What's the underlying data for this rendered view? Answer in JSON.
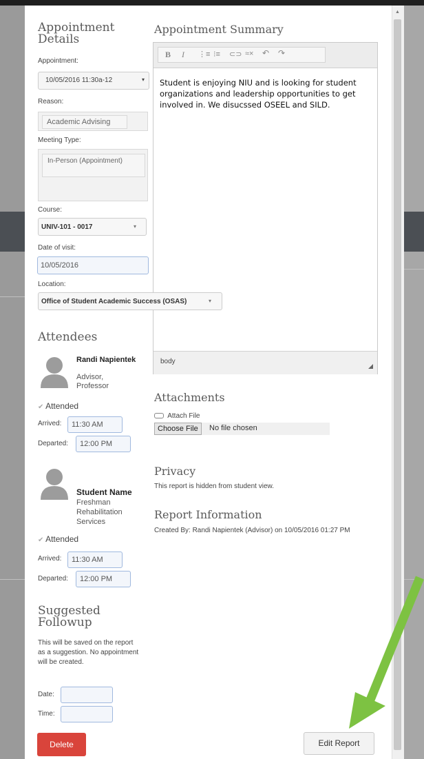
{
  "details": {
    "title": "Appointment Details",
    "appointment_label": "Appointment:",
    "appointment_value": "10/05/2016 11:30a-12",
    "reason_label": "Reason:",
    "reason_value": "Academic Advising",
    "meeting_type_label": "Meeting Type:",
    "meeting_type_value": "In-Person (Appointment)",
    "course_label": "Course:",
    "course_value": "UNIV-101 - 0017",
    "date_label": "Date of visit:",
    "date_value": "10/05/2016",
    "location_label": "Location:",
    "location_value": "Office of Student Academic Success (OSAS)"
  },
  "attendees": {
    "title": "Attendees",
    "people": [
      {
        "name": "Randi Napientek",
        "role": "Advisor, Professor",
        "attended_label": "Attended",
        "arrived_label": "Arrived:",
        "arrived_value": "11:30 AM",
        "departed_label": "Departed:",
        "departed_value": "12:00 PM"
      },
      {
        "name": "Student Name",
        "role": "Freshman Rehabilitation Services",
        "attended_label": "Attended",
        "arrived_label": "Arrived:",
        "arrived_value": "11:30 AM",
        "departed_label": "Departed:",
        "departed_value": "12:00 PM"
      }
    ]
  },
  "followup": {
    "title": "Suggested Followup",
    "note": "This will be saved on the report as a suggestion. No appointment will be created.",
    "date_label": "Date:",
    "time_label": "Time:"
  },
  "summary": {
    "title": "Appointment Summary",
    "text": "Student is enjoying NIU and is looking for student organizations and leadership opportunities to get involved in. We disucssed OSEEL and SILD.",
    "status_bar": "body",
    "toolbar_icons": [
      "bold-icon",
      "italic-icon",
      "ordered-list-icon",
      "unordered-list-icon",
      "link-icon",
      "unlink-icon",
      "undo-icon",
      "redo-icon"
    ]
  },
  "attachments": {
    "title": "Attachments",
    "attach_label": "Attach File",
    "choose_label": "Choose File",
    "no_file_label": "No file chosen"
  },
  "privacy": {
    "title": "Privacy",
    "text": "This report is hidden from student view."
  },
  "report_info": {
    "title": "Report Information",
    "text": "Created By: Randi Napientek (Advisor) on 10/05/2016 01:27 PM"
  },
  "buttons": {
    "delete": "Delete",
    "edit_report": "Edit Report"
  },
  "colors": {
    "delete_bg": "#d9443b",
    "arrow": "#7dc242",
    "input_border": "#9fb8de"
  }
}
